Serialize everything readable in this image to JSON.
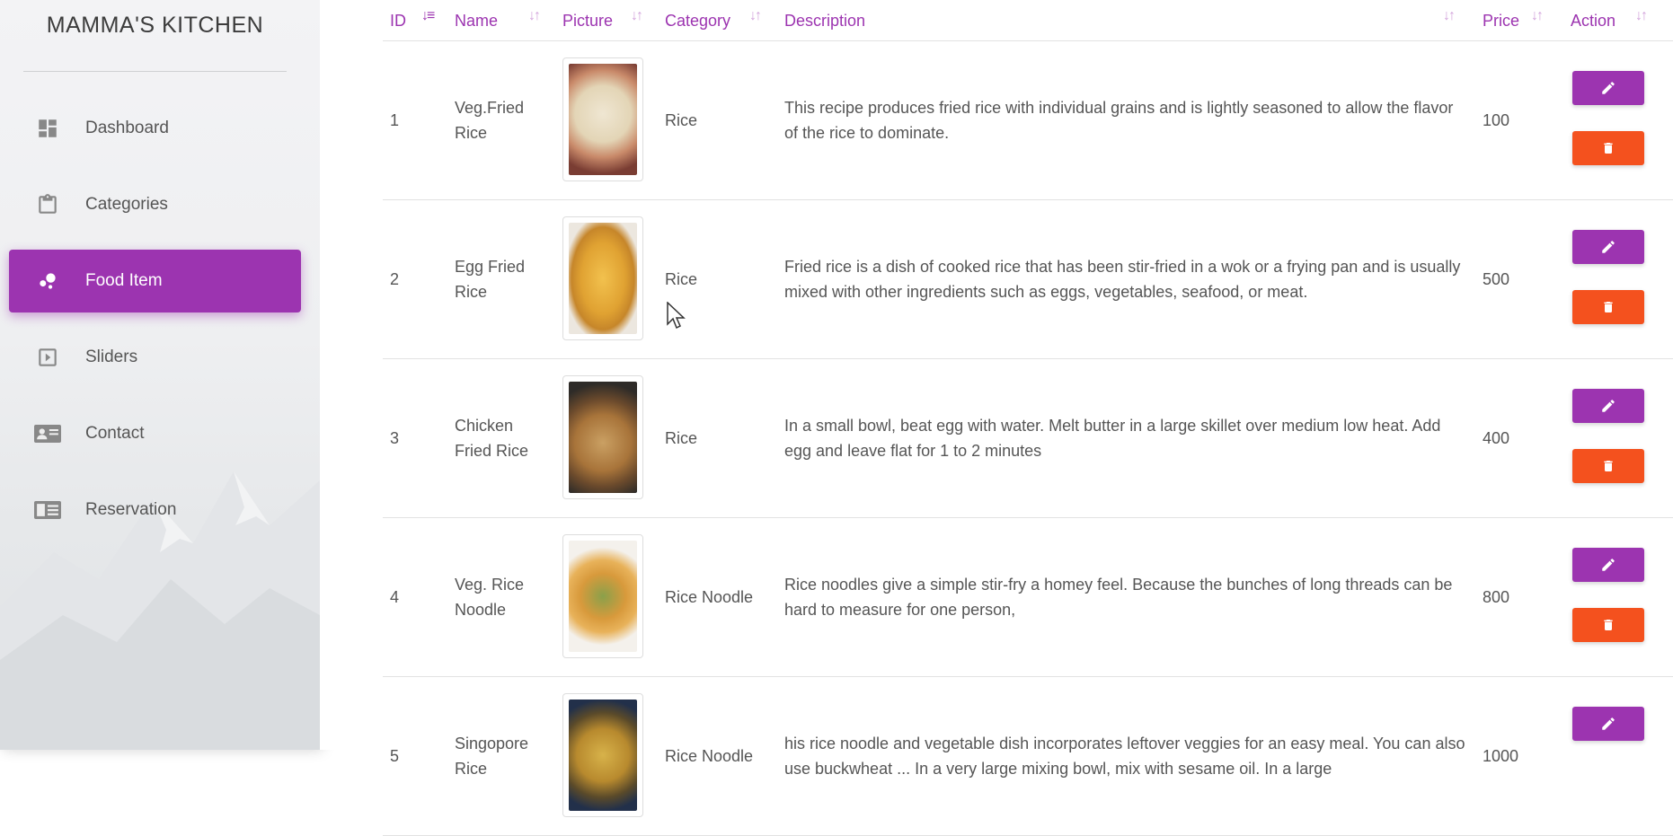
{
  "brand": "MAMMA'S KITCHEN",
  "nav": [
    {
      "label": "Dashboard",
      "icon": "dashboard-icon",
      "active": false
    },
    {
      "label": "Categories",
      "icon": "clipboard-icon",
      "active": false
    },
    {
      "label": "Food Item",
      "icon": "bubble-chart-icon",
      "active": true
    },
    {
      "label": "Sliders",
      "icon": "slideshow-icon",
      "active": false
    },
    {
      "label": "Contact",
      "icon": "contact-card-icon",
      "active": false
    },
    {
      "label": "Reservation",
      "icon": "reservation-icon",
      "active": false
    }
  ],
  "table": {
    "headers": {
      "id": "ID",
      "name": "Name",
      "picture": "Picture",
      "category": "Category",
      "description": "Description",
      "price": "Price",
      "action": "Action"
    },
    "sort_icon": "sort-icon",
    "sorted_column": "id",
    "rows": [
      {
        "id": "1",
        "name": "Veg.Fried Rice",
        "category": "Rice",
        "description": "This recipe produces fried rice with individual grains and is lightly seasoned to allow the flavor of the rice to dominate.",
        "price": "100"
      },
      {
        "id": "2",
        "name": "Egg Fried Rice",
        "category": "Rice",
        "description": "Fried rice is a dish of cooked rice that has been stir-fried in a wok or a frying pan and is usually mixed with other ingredients such as eggs, vegetables, seafood, or meat.",
        "price": "500"
      },
      {
        "id": "3",
        "name": "Chicken Fried Rice",
        "category": "Rice",
        "description": "In a small bowl, beat egg with water. Melt butter in a large skillet over medium low heat. Add egg and leave flat for 1 to 2 minutes",
        "price": "400"
      },
      {
        "id": "4",
        "name": "Veg. Rice Noodle",
        "category": "Rice Noodle",
        "description": "Rice noodles give a simple stir-fry a homey feel. Because the bunches of long threads can be hard to measure for one person,",
        "price": "800"
      },
      {
        "id": "5",
        "name": "Singopore Rice",
        "category": "Rice Noodle",
        "description": "his rice noodle and vegetable dish incorporates leftover veggies for an easy meal. You can also use buckwheat ... In a very large mixing bowl, mix with sesame oil. In a large",
        "price": "1000"
      }
    ]
  },
  "actions": {
    "edit_icon": "pencil-icon",
    "delete_icon": "trash-icon"
  },
  "colors": {
    "accent": "#9c34b0",
    "danger": "#f4511e"
  }
}
